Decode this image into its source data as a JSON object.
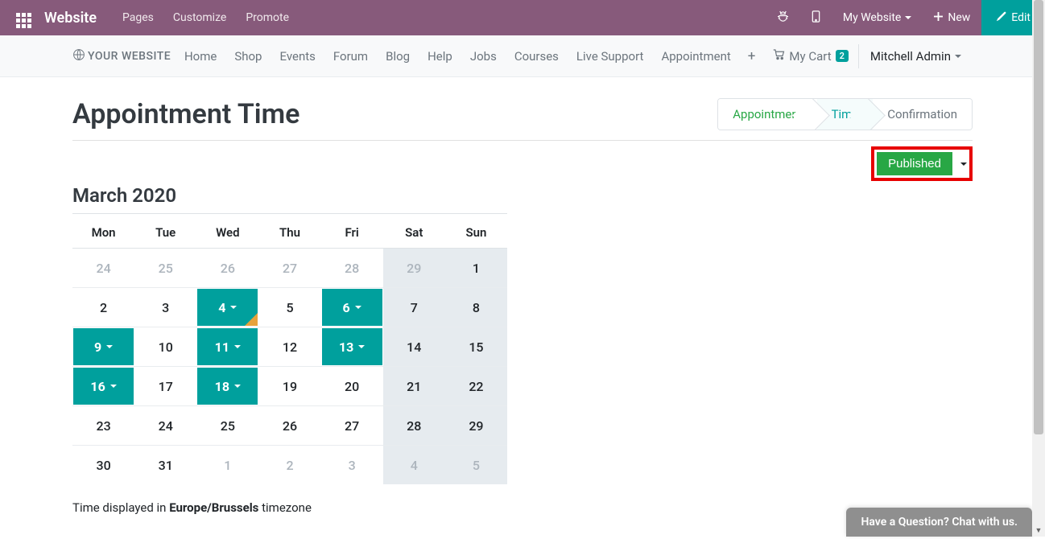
{
  "topbar": {
    "brand": "Website",
    "menu": [
      "Pages",
      "Customize",
      "Promote"
    ],
    "my_website": "My Website",
    "new": "New",
    "edit": "Edit"
  },
  "subbar": {
    "logo_text": "YOUR WEBSITE",
    "nav": [
      "Home",
      "Shop",
      "Events",
      "Forum",
      "Blog",
      "Help",
      "Jobs",
      "Courses",
      "Live Support",
      "Appointment"
    ],
    "cart_label": "My Cart",
    "cart_count": "2",
    "user": "Mitchell Admin"
  },
  "page": {
    "title": "Appointment Time",
    "wizard": {
      "step1": "Appointment",
      "step2": "Time",
      "step3": "Confirmation"
    },
    "published": "Published",
    "cal_title": "March 2020",
    "weekdays": [
      "Mon",
      "Tue",
      "Wed",
      "Thu",
      "Fri",
      "Sat",
      "Sun"
    ],
    "rows": [
      [
        {
          "n": "24",
          "cls": "other"
        },
        {
          "n": "25",
          "cls": "other"
        },
        {
          "n": "26",
          "cls": "other"
        },
        {
          "n": "27",
          "cls": "other"
        },
        {
          "n": "28",
          "cls": "other"
        },
        {
          "n": "29",
          "cls": "weekend other"
        },
        {
          "n": "1",
          "cls": "weekend"
        }
      ],
      [
        {
          "n": "2",
          "cls": ""
        },
        {
          "n": "3",
          "cls": ""
        },
        {
          "n": "4",
          "cls": "avail corner"
        },
        {
          "n": "5",
          "cls": ""
        },
        {
          "n": "6",
          "cls": "avail"
        },
        {
          "n": "7",
          "cls": "weekend"
        },
        {
          "n": "8",
          "cls": "weekend"
        }
      ],
      [
        {
          "n": "9",
          "cls": "avail"
        },
        {
          "n": "10",
          "cls": ""
        },
        {
          "n": "11",
          "cls": "avail"
        },
        {
          "n": "12",
          "cls": ""
        },
        {
          "n": "13",
          "cls": "avail"
        },
        {
          "n": "14",
          "cls": "weekend"
        },
        {
          "n": "15",
          "cls": "weekend"
        }
      ],
      [
        {
          "n": "16",
          "cls": "avail"
        },
        {
          "n": "17",
          "cls": ""
        },
        {
          "n": "18",
          "cls": "avail"
        },
        {
          "n": "19",
          "cls": ""
        },
        {
          "n": "20",
          "cls": ""
        },
        {
          "n": "21",
          "cls": "weekend"
        },
        {
          "n": "22",
          "cls": "weekend"
        }
      ],
      [
        {
          "n": "23",
          "cls": ""
        },
        {
          "n": "24",
          "cls": ""
        },
        {
          "n": "25",
          "cls": ""
        },
        {
          "n": "26",
          "cls": ""
        },
        {
          "n": "27",
          "cls": ""
        },
        {
          "n": "28",
          "cls": "weekend"
        },
        {
          "n": "29",
          "cls": "weekend"
        }
      ],
      [
        {
          "n": "30",
          "cls": ""
        },
        {
          "n": "31",
          "cls": ""
        },
        {
          "n": "1",
          "cls": "other"
        },
        {
          "n": "2",
          "cls": "other"
        },
        {
          "n": "3",
          "cls": "other"
        },
        {
          "n": "4",
          "cls": "weekend other"
        },
        {
          "n": "5",
          "cls": "weekend other"
        }
      ]
    ],
    "tz_prefix": "Time displayed in ",
    "tz_value": "Europe/Brussels",
    "tz_suffix": " timezone"
  },
  "chat": "Have a Question? Chat with us."
}
